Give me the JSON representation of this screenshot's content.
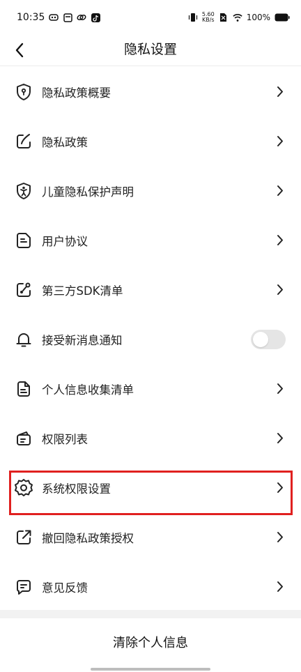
{
  "status_bar": {
    "time": "10:35",
    "net_speed_value": "5.60",
    "net_speed_unit": "KB/s",
    "battery": "100%"
  },
  "header": {
    "title": "隐私设置"
  },
  "items": [
    {
      "label": "隐私政策概要",
      "icon": "shield-lock-icon",
      "control": "chevron"
    },
    {
      "label": "隐私政策",
      "icon": "edit-document-icon",
      "control": "chevron"
    },
    {
      "label": "儿童隐私保护声明",
      "icon": "child-shield-icon",
      "control": "chevron"
    },
    {
      "label": "用户协议",
      "icon": "agreement-doc-icon",
      "control": "chevron"
    },
    {
      "label": "第三方SDK清单",
      "icon": "share-node-icon",
      "control": "chevron"
    },
    {
      "label": "接受新消息通知",
      "icon": "bell-icon",
      "control": "toggle",
      "toggle_on": false
    },
    {
      "label": "个人信息收集清单",
      "icon": "document-list-icon",
      "control": "chevron"
    },
    {
      "label": "权限列表",
      "icon": "wallet-icon",
      "control": "chevron"
    },
    {
      "label": "系统权限设置",
      "icon": "gear-icon",
      "control": "chevron"
    },
    {
      "label": "撤回隐私政策授权",
      "icon": "external-edit-icon",
      "control": "chevron"
    },
    {
      "label": "意见反馈",
      "icon": "feedback-chat-icon",
      "control": "chevron"
    }
  ],
  "highlighted_item": "系统权限设置",
  "footer": {
    "clear_button": "清除个人信息"
  },
  "colors": {
    "highlight": "#e0201f",
    "text": "#222222",
    "divider": "#f2f2f2"
  }
}
